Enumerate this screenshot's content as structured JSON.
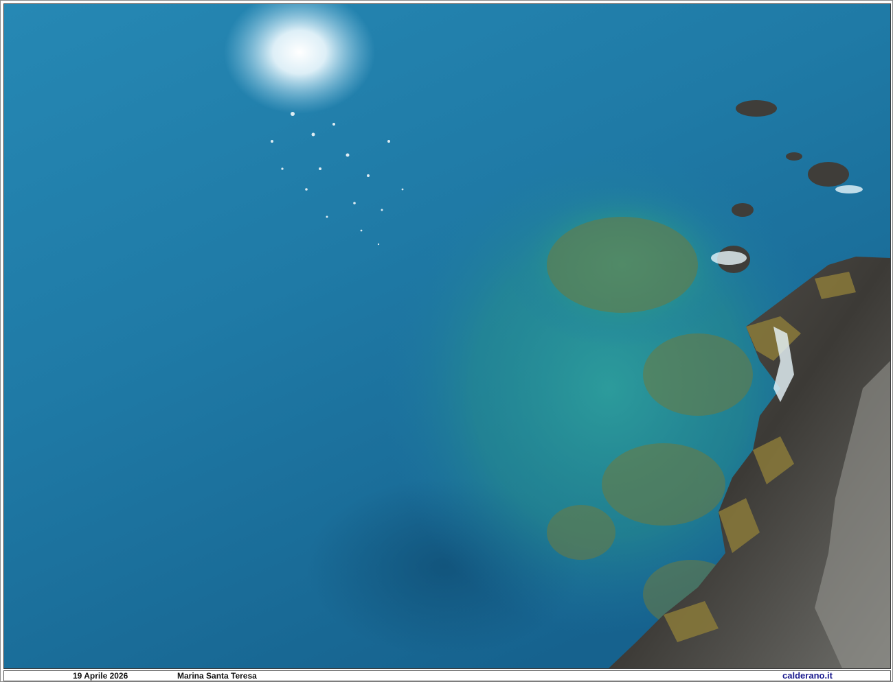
{
  "photo": {
    "subject": "sea",
    "colors": {
      "deep_water": "#1a6a95",
      "mid_water": "#1f7aa6",
      "shallow_water": "#2a9a9e",
      "rock_dark": "#3a3a3a",
      "rock_light": "#7a7a72",
      "algae": "#8a7a3a",
      "sun_glare": "#ffffff"
    }
  },
  "caption": {
    "date": "19 Aprile 2026",
    "place": "Marina Santa Teresa",
    "site": "calderano.it"
  }
}
